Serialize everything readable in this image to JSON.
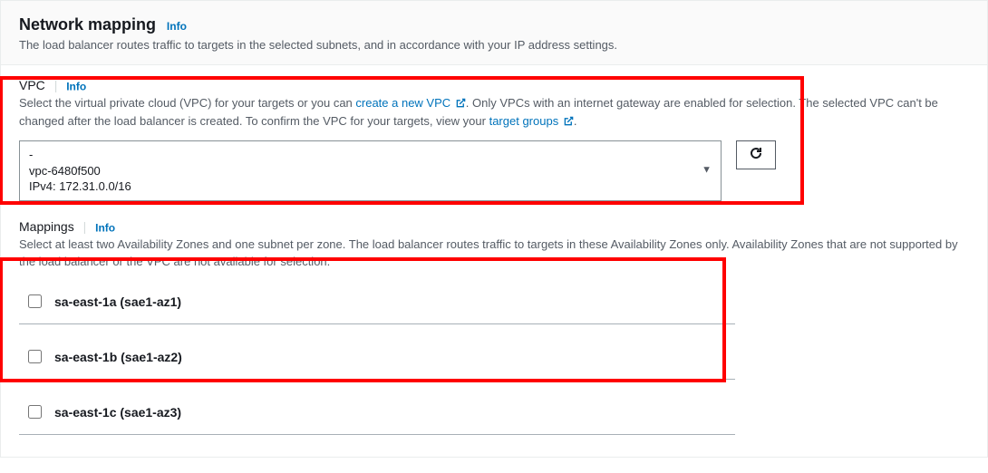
{
  "header": {
    "title": "Network mapping",
    "info": "Info",
    "description": "The load balancer routes traffic to targets in the selected subnets, and in accordance with your IP address settings."
  },
  "vpc": {
    "label": "VPC",
    "info": "Info",
    "help_pre": "Select the virtual private cloud (VPC) for your targets or you can ",
    "create_link": "create a new VPC",
    "help_mid": ". Only VPCs with an internet gateway are enabled for selection. The selected VPC can't be changed after the load balancer is created. To confirm the VPC for your targets, view your ",
    "target_groups_link": "target groups",
    "help_post": ".",
    "selected": {
      "dash": "-",
      "id": "vpc-6480f500",
      "cidr": "IPv4: 172.31.0.0/16"
    }
  },
  "mappings": {
    "label": "Mappings",
    "info": "Info",
    "help": "Select at least two Availability Zones and one subnet per zone. The load balancer routes traffic to targets in these Availability Zones only. Availability Zones that are not supported by the load balancer or the VPC are not available for selection.",
    "zones": [
      {
        "label": "sa-east-1a (sae1-az1)"
      },
      {
        "label": "sa-east-1b (sae1-az2)"
      },
      {
        "label": "sa-east-1c (sae1-az3)"
      }
    ]
  }
}
